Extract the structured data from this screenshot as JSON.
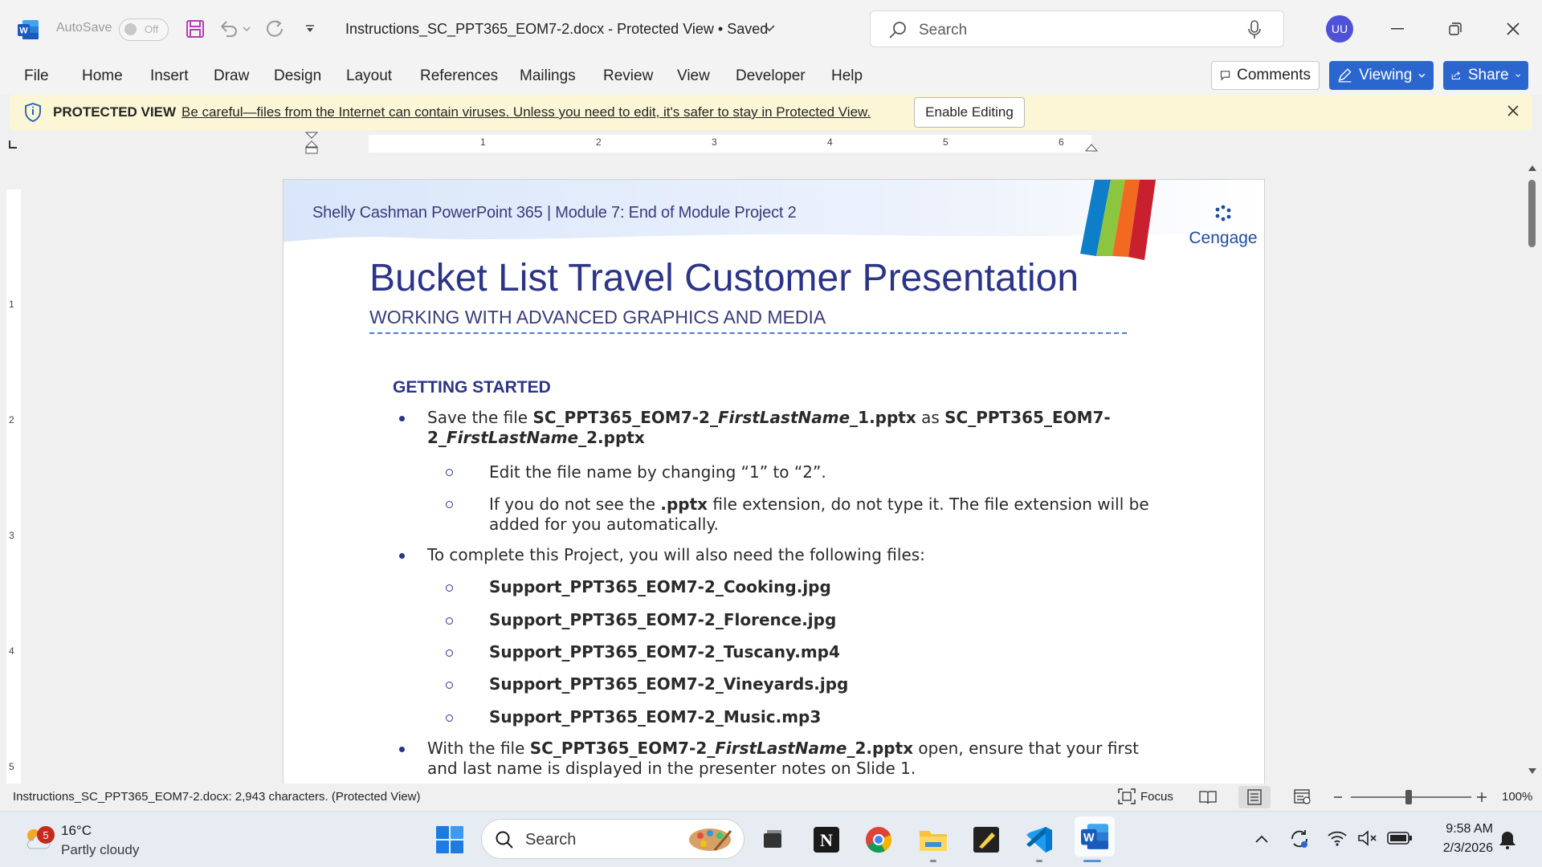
{
  "titlebar": {
    "autosave_label": "AutoSave",
    "autosave_state": "Off",
    "document_title": "Instructions_SC_PPT365_EOM7-2.docx  -  Protected View • Saved",
    "search_placeholder": "Search",
    "user_initials": "UU"
  },
  "menu": {
    "items": [
      "File",
      "Home",
      "Insert",
      "Draw",
      "Design",
      "Layout",
      "References",
      "Mailings",
      "Review",
      "View",
      "Developer",
      "Help"
    ],
    "comments_label": "Comments",
    "viewing_label": "Viewing",
    "share_label": "Share"
  },
  "protected_view": {
    "label": "PROTECTED VIEW",
    "message": "Be careful—files from the Internet can contain viruses. Unless you need to edit, it's safer to stay in Protected View.",
    "enable_button": "Enable Editing"
  },
  "ruler": {
    "horizontal_numbers": [
      "1",
      "2",
      "3",
      "4",
      "5",
      "6"
    ],
    "vertical_numbers": [
      "1",
      "2",
      "3",
      "4",
      "5"
    ]
  },
  "document": {
    "header_text": "Shelly Cashman PowerPoint 365  |  Module 7: End of Module Project 2",
    "brand": "Cengage",
    "title": "Bucket List Travel Customer Presentation",
    "subtitle": "WORKING WITH ADVANCED GRAPHICS AND MEDIA",
    "section_heading": "GETTING STARTED",
    "b1": {
      "p1": "Save the file ",
      "f1a": "SC_PPT365_EOM7-2_",
      "f1b": "FirstLastName",
      "f1c": "_1.pptx",
      "p2": " as ",
      "f2a": "SC_PPT365_EOM7-",
      "f2b": "2_",
      "f2c": "FirstLastName",
      "f2d": "_2.pptx"
    },
    "sub1": "Edit the file name by changing “1” to “2”.",
    "sub2": {
      "p1": "If you do not see the ",
      "ext": ".pptx",
      "p2": " file extension, do not type it. The file extension will be",
      "line2": "added for you automatically."
    },
    "b2": "To complete this Project, you will also need the following files:",
    "files": [
      "Support_PPT365_EOM7-2_Cooking.jpg",
      "Support_PPT365_EOM7-2_Florence.jpg",
      "Support_PPT365_EOM7-2_Tuscany.mp4",
      "Support_PPT365_EOM7-2_Vineyards.jpg",
      "Support_PPT365_EOM7-2_Music.mp3"
    ],
    "b3": {
      "p1": "With the file ",
      "fa": "SC_PPT365_EOM7-2_",
      "fb": "FirstLastName",
      "fc": "_2.pptx",
      "p2": " open, ensure that your first",
      "line2": "and last name is displayed in the presenter notes on Slide 1."
    }
  },
  "statusbar": {
    "info": "Instructions_SC_PPT365_EOM7-2.docx: 2,943 characters.  (Protected View)",
    "focus_label": "Focus",
    "zoom": "100%"
  },
  "taskbar": {
    "weather_badge": "5",
    "temperature": "16°C",
    "condition": "Partly cloudy",
    "search_placeholder": "Search",
    "time": "9:58 AM",
    "date": "2/3/2026"
  },
  "colors": {
    "word_blue": "#2b66cf",
    "heading_navy": "#2c3488",
    "protected_bar": "#fdf6d6"
  }
}
